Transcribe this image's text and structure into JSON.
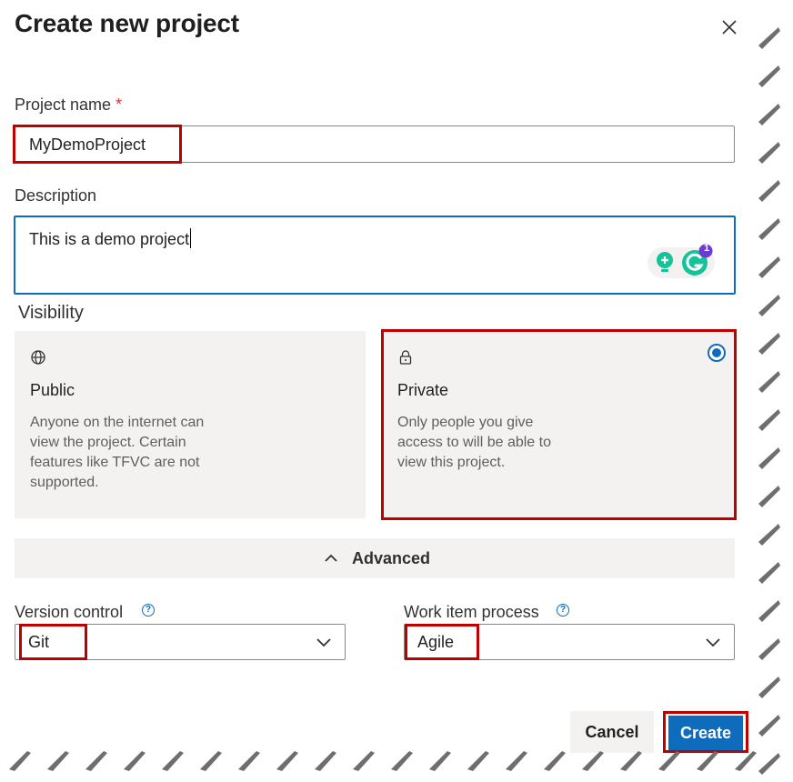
{
  "dialog": {
    "title": "Create new project",
    "close_label": "Close"
  },
  "project_name": {
    "label": "Project name",
    "required_mark": "*",
    "value": "MyDemoProject"
  },
  "description": {
    "label": "Description",
    "value": "This is a demo project",
    "grammarly_badge_count": "1"
  },
  "visibility": {
    "label": "Visibility",
    "options": [
      {
        "name": "Public",
        "text": "Anyone on the internet can view the project. Certain features like TFVC are not supported.",
        "icon": "globe-icon"
      },
      {
        "name": "Private",
        "text": "Only people you give access to will be able to view this project.",
        "icon": "lock-icon",
        "selected": true
      }
    ]
  },
  "advanced": {
    "label": "Advanced"
  },
  "version_control": {
    "label": "Version control",
    "value": "Git",
    "help": "?"
  },
  "work_item_process": {
    "label": "Work item process",
    "value": "Agile",
    "help": "?"
  },
  "buttons": {
    "cancel": "Cancel",
    "create": "Create"
  },
  "colors": {
    "accent": "#0f6cbd",
    "highlight": "#c00000",
    "card_bg": "#f3f2f1"
  }
}
